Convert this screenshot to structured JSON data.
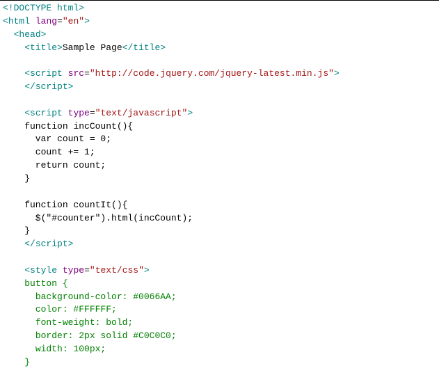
{
  "lines": [
    [
      {
        "cls": "t-punc",
        "txt": "<!"
      },
      {
        "cls": "t-tag",
        "txt": "DOCTYPE html"
      },
      {
        "cls": "t-punc",
        "txt": ">"
      }
    ],
    [
      {
        "cls": "t-punc",
        "txt": "<"
      },
      {
        "cls": "t-tag",
        "txt": "html"
      },
      {
        "cls": "",
        "txt": " "
      },
      {
        "cls": "t-attr",
        "txt": "lang"
      },
      {
        "cls": "",
        "txt": "="
      },
      {
        "cls": "t-str",
        "txt": "\"en\""
      },
      {
        "cls": "t-punc",
        "txt": ">"
      }
    ],
    [
      {
        "cls": "",
        "txt": "  "
      },
      {
        "cls": "t-punc",
        "txt": "<"
      },
      {
        "cls": "t-tag",
        "txt": "head"
      },
      {
        "cls": "t-punc",
        "txt": ">"
      }
    ],
    [
      {
        "cls": "",
        "txt": "    "
      },
      {
        "cls": "t-punc",
        "txt": "<"
      },
      {
        "cls": "t-tag",
        "txt": "title"
      },
      {
        "cls": "t-punc",
        "txt": ">"
      },
      {
        "cls": "",
        "txt": "Sample Page"
      },
      {
        "cls": "t-punc",
        "txt": "</"
      },
      {
        "cls": "t-tag",
        "txt": "title"
      },
      {
        "cls": "t-punc",
        "txt": ">"
      }
    ],
    [],
    [
      {
        "cls": "",
        "txt": "    "
      },
      {
        "cls": "t-punc",
        "txt": "<"
      },
      {
        "cls": "t-tag",
        "txt": "script"
      },
      {
        "cls": "",
        "txt": " "
      },
      {
        "cls": "t-attr",
        "txt": "src"
      },
      {
        "cls": "",
        "txt": "="
      },
      {
        "cls": "t-str",
        "txt": "\"http://code.jquery.com/jquery-latest.min.js\""
      },
      {
        "cls": "t-punc",
        "txt": ">"
      }
    ],
    [
      {
        "cls": "",
        "txt": "    "
      },
      {
        "cls": "t-punc",
        "txt": "</"
      },
      {
        "cls": "t-tag",
        "txt": "script"
      },
      {
        "cls": "t-punc",
        "txt": ">"
      }
    ],
    [],
    [
      {
        "cls": "",
        "txt": "    "
      },
      {
        "cls": "t-punc",
        "txt": "<"
      },
      {
        "cls": "t-tag",
        "txt": "script"
      },
      {
        "cls": "",
        "txt": " "
      },
      {
        "cls": "t-attr",
        "txt": "type"
      },
      {
        "cls": "",
        "txt": "="
      },
      {
        "cls": "t-str",
        "txt": "\"text/javascript\""
      },
      {
        "cls": "t-punc",
        "txt": ">"
      }
    ],
    [
      {
        "cls": "",
        "txt": "    function incCount(){"
      }
    ],
    [
      {
        "cls": "",
        "txt": "      var count = 0;"
      }
    ],
    [
      {
        "cls": "",
        "txt": "      count += 1;"
      }
    ],
    [
      {
        "cls": "",
        "txt": "      return count;"
      }
    ],
    [
      {
        "cls": "",
        "txt": "    }"
      }
    ],
    [],
    [
      {
        "cls": "",
        "txt": "    function countIt(){"
      }
    ],
    [
      {
        "cls": "",
        "txt": "      $(\"#counter\").html(incCount);"
      }
    ],
    [
      {
        "cls": "",
        "txt": "    }"
      }
    ],
    [
      {
        "cls": "",
        "txt": "    "
      },
      {
        "cls": "t-punc",
        "txt": "</"
      },
      {
        "cls": "t-tag",
        "txt": "script"
      },
      {
        "cls": "t-punc",
        "txt": ">"
      }
    ],
    [],
    [
      {
        "cls": "",
        "txt": "    "
      },
      {
        "cls": "t-punc",
        "txt": "<"
      },
      {
        "cls": "t-tag",
        "txt": "style"
      },
      {
        "cls": "",
        "txt": " "
      },
      {
        "cls": "t-attr",
        "txt": "type"
      },
      {
        "cls": "",
        "txt": "="
      },
      {
        "cls": "t-str",
        "txt": "\"text/css\""
      },
      {
        "cls": "t-punc",
        "txt": ">"
      }
    ],
    [
      {
        "cls": "",
        "txt": "    "
      },
      {
        "cls": "t-css",
        "txt": "button {"
      }
    ],
    [
      {
        "cls": "",
        "txt": "      "
      },
      {
        "cls": "t-css",
        "txt": "background-color: #0066AA;"
      }
    ],
    [
      {
        "cls": "",
        "txt": "      "
      },
      {
        "cls": "t-css",
        "txt": "color: #FFFFFF;"
      }
    ],
    [
      {
        "cls": "",
        "txt": "      "
      },
      {
        "cls": "t-css",
        "txt": "font-weight: bold;"
      }
    ],
    [
      {
        "cls": "",
        "txt": "      "
      },
      {
        "cls": "t-css",
        "txt": "border: 2px solid #C0C0C0;"
      }
    ],
    [
      {
        "cls": "",
        "txt": "      "
      },
      {
        "cls": "t-css",
        "txt": "width: 100px;"
      }
    ],
    [
      {
        "cls": "",
        "txt": "    "
      },
      {
        "cls": "t-css",
        "txt": "}"
      }
    ]
  ]
}
